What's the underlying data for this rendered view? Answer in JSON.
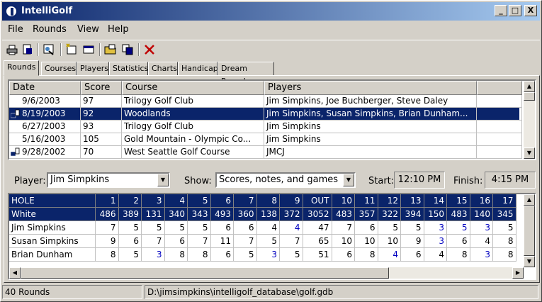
{
  "window": {
    "title": "IntelliGolf",
    "min": "_",
    "max": "□",
    "close": "X"
  },
  "menu": [
    "File",
    "Rounds",
    "View",
    "Help"
  ],
  "tabs": [
    "Rounds",
    "Courses",
    "Players",
    "Statistics",
    "Charts",
    "Handicap",
    "Dream Round"
  ],
  "rounds": {
    "columns": [
      "Date",
      "Score",
      "Course",
      "Players"
    ],
    "rows": [
      {
        "date": "9/6/2003",
        "score": "97",
        "course": "Trilogy Golf Club",
        "players": "Jim Simpkins, Joe Buchberger, Steve Daley",
        "locked": false,
        "selected": false
      },
      {
        "date": "8/19/2003",
        "score": "92",
        "course": "Woodlands",
        "players": "Jim Simpkins, Susan Simpkins, Brian Dunham...",
        "locked": true,
        "selected": true
      },
      {
        "date": "6/27/2003",
        "score": "93",
        "course": "Trilogy Golf Club",
        "players": "Jim Simpkins",
        "locked": false,
        "selected": false
      },
      {
        "date": "5/16/2003",
        "score": "105",
        "course": "Gold Mountain - Olympic Co...",
        "players": "Jim Simpkins",
        "locked": false,
        "selected": false
      },
      {
        "date": "9/28/2002",
        "score": "70",
        "course": "West Seattle Golf Course",
        "players": "JMCJ",
        "locked": true,
        "selected": false
      }
    ]
  },
  "filters": {
    "player_label": "Player:",
    "player_value": "Jim Simpkins",
    "show_label": "Show:",
    "show_value": "Scores, notes, and games",
    "start_label": "Start:",
    "start_value": "12:10 PM",
    "finish_label": "Finish:",
    "finish_value": "4:15 PM"
  },
  "scorecard": {
    "columns": [
      "HOLE",
      "1",
      "2",
      "3",
      "4",
      "5",
      "6",
      "7",
      "8",
      "9",
      "OUT",
      "10",
      "11",
      "12",
      "13",
      "14",
      "15",
      "16",
      "17"
    ],
    "yardage_label": "White",
    "yardage": [
      "486",
      "389",
      "131",
      "340",
      "343",
      "493",
      "360",
      "138",
      "372",
      "3052",
      "483",
      "357",
      "322",
      "394",
      "150",
      "483",
      "140",
      "345"
    ],
    "players": [
      {
        "name": "Jim Simpkins",
        "scores": [
          "7",
          "5",
          "5",
          "5",
          "5",
          "6",
          "6",
          "4",
          "4",
          "47",
          "7",
          "6",
          "5",
          "5",
          "3",
          "5",
          "3",
          "5"
        ],
        "blue": [
          8,
          14,
          15,
          16
        ]
      },
      {
        "name": "Susan Simpkins",
        "scores": [
          "9",
          "6",
          "7",
          "6",
          "7",
          "11",
          "7",
          "5",
          "7",
          "65",
          "10",
          "10",
          "10",
          "9",
          "3",
          "6",
          "4",
          "8"
        ],
        "blue": [
          14
        ]
      },
      {
        "name": "Brian Dunham",
        "scores": [
          "8",
          "5",
          "3",
          "8",
          "8",
          "6",
          "5",
          "3",
          "5",
          "51",
          "6",
          "8",
          "4",
          "6",
          "4",
          "8",
          "3",
          "8"
        ],
        "blue": [
          2,
          7,
          12,
          16
        ]
      }
    ],
    "score_blue_color": "#0000c0"
  },
  "status": {
    "count": "40 Rounds",
    "path": "D:\\jimsimpkins\\intelligolf_database\\golf.gdb"
  }
}
